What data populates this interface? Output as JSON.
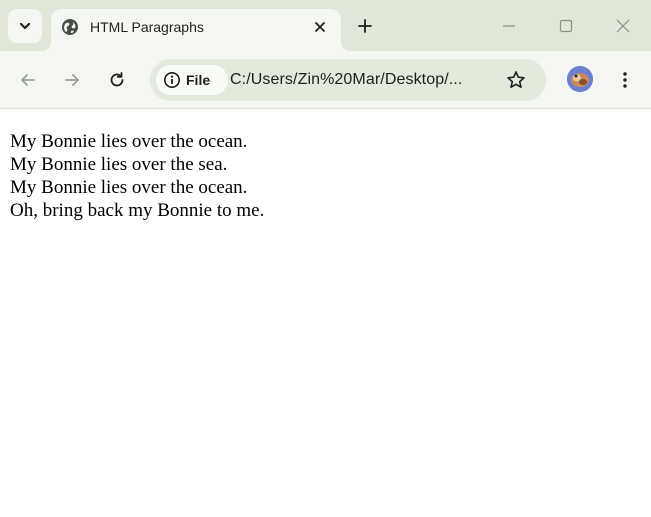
{
  "tab": {
    "title": "HTML Paragraphs"
  },
  "address_bar": {
    "chip_label": "File",
    "url": "C:/Users/Zin%20Mar/Desktop/..."
  },
  "page": {
    "lines": [
      "My Bonnie lies over the ocean.",
      "My Bonnie lies over the sea.",
      "My Bonnie lies over the ocean.",
      "Oh, bring back my Bonnie to me."
    ]
  },
  "icons": {
    "tab_search": "chevron-down-icon",
    "favicon": "globe-icon",
    "close": "close-icon",
    "new_tab": "plus-icon",
    "minimize": "minimize-icon",
    "maximize": "maximize-icon",
    "window_close": "window-close-icon",
    "back": "back-arrow-icon",
    "forward": "forward-arrow-icon",
    "reload": "reload-icon",
    "info": "info-icon",
    "bookmark": "star-icon",
    "profile": "avatar",
    "menu": "kebab-menu-icon"
  },
  "colors": {
    "tabstrip": "#dfe8d8",
    "toolbar": "#f4f7f1",
    "omnibox": "#e2eadb",
    "text": "#1f1f1f"
  }
}
